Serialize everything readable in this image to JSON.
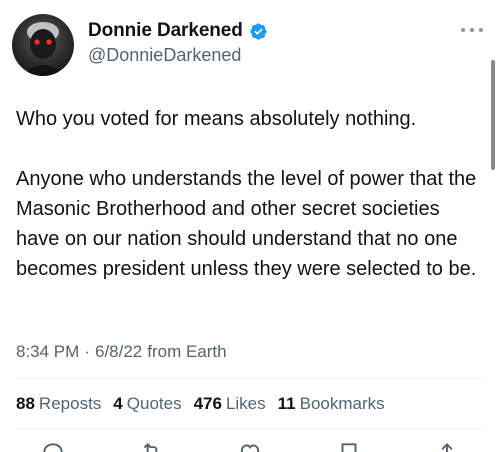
{
  "author": {
    "display_name": "Donnie Darkened",
    "handle": "@DonnieDarkened",
    "verified": true,
    "verified_color": "#1d9bf0"
  },
  "tweet": {
    "paragraphs": [
      "Who you voted for means absolutely nothing.",
      "Anyone who understands the level of power that the Masonic Brotherhood and other secret societies have on our nation should understand that no one becomes president unless they were selected to be."
    ]
  },
  "meta": {
    "time": "8:34 PM",
    "separator": "·",
    "date": "6/8/22",
    "source": "from Earth"
  },
  "stats": [
    {
      "count": "88",
      "label": "Reposts"
    },
    {
      "count": "4",
      "label": "Quotes"
    },
    {
      "count": "476",
      "label": "Likes"
    },
    {
      "count": "11",
      "label": "Bookmarks"
    }
  ],
  "icons": {
    "more": "more-options-icon",
    "actions": [
      "reply-icon",
      "repost-icon",
      "like-icon",
      "bookmark-icon",
      "share-icon"
    ]
  },
  "colors": {
    "text_primary": "#0f1419",
    "text_secondary": "#536471",
    "divider": "#eff3f4"
  }
}
